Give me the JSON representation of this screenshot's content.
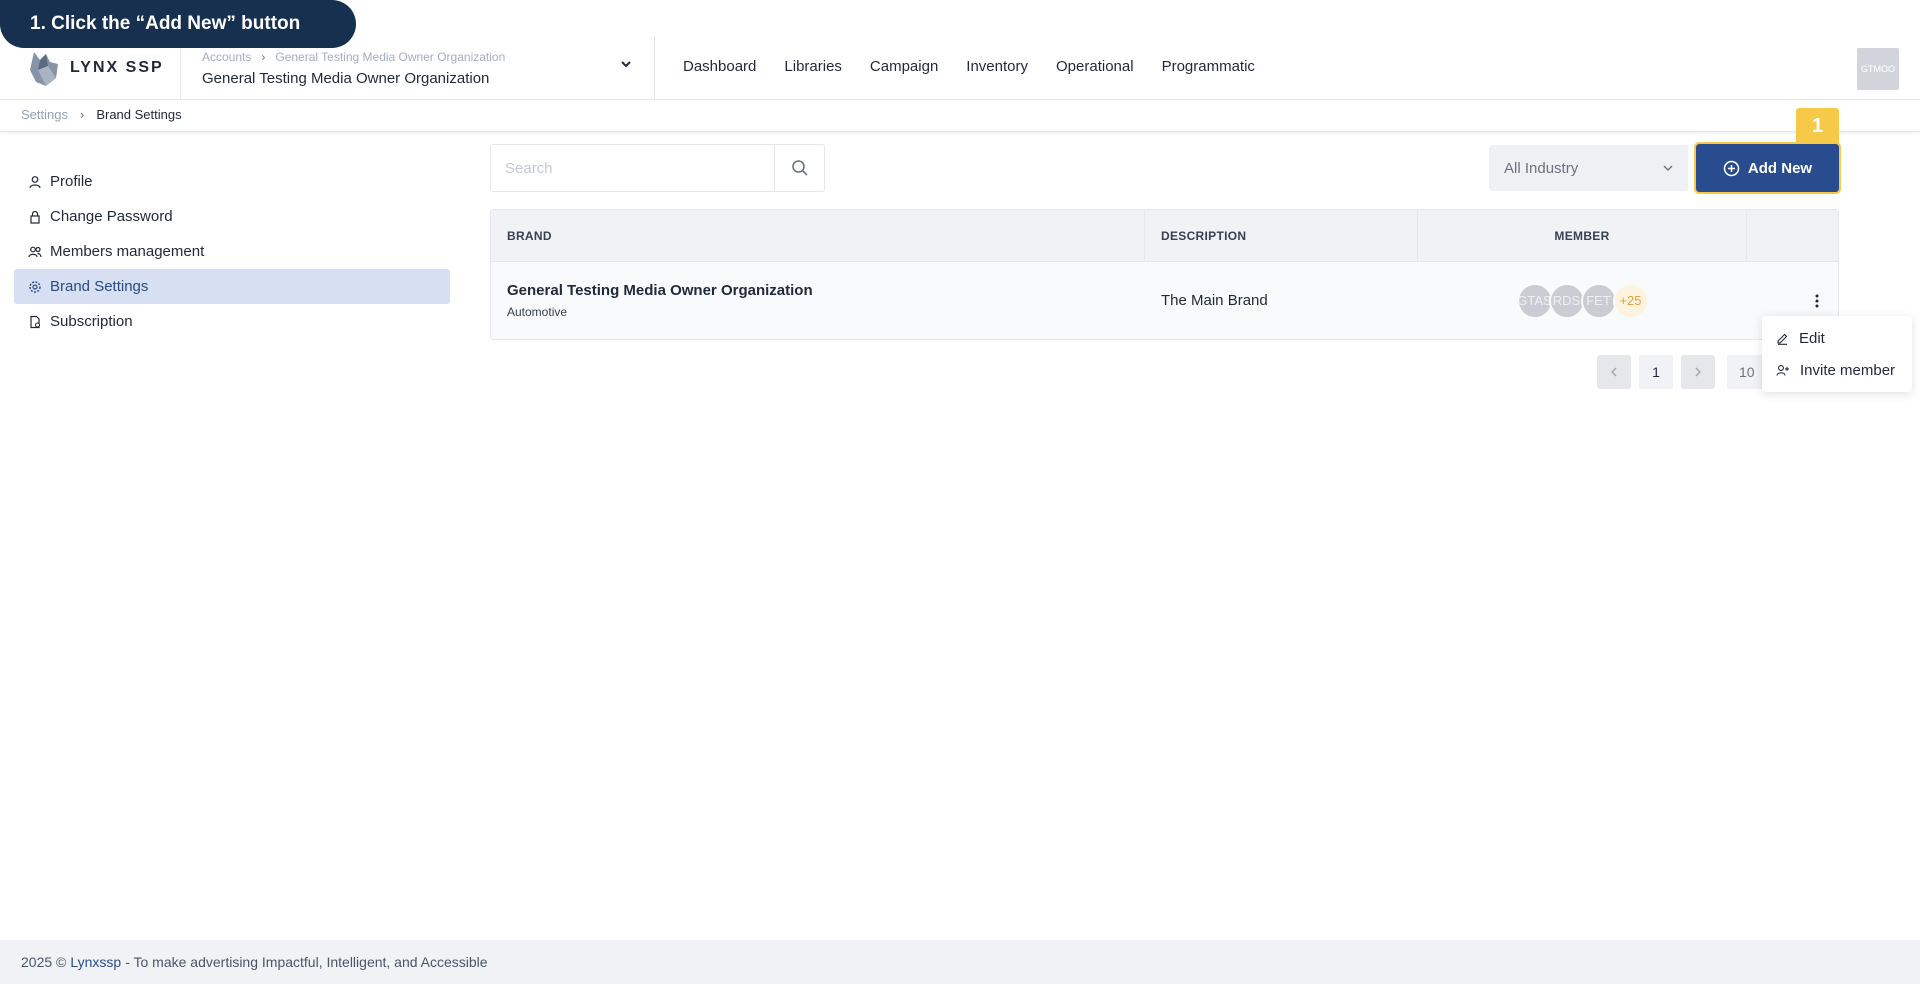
{
  "tutorial": {
    "step_text": "1. Click the “Add New” button",
    "badge_number": "1"
  },
  "header": {
    "logo_text": "LYNX SSP",
    "account_breadcrumb": [
      "Accounts",
      "General Testing Media Owner Organization"
    ],
    "account_title": "General Testing Media Owner Organization",
    "nav": [
      "Dashboard",
      "Libraries",
      "Campaign",
      "Inventory",
      "Operational",
      "Programmatic"
    ],
    "avatar_text": "GTMOO"
  },
  "breadcrumb": {
    "parent": "Settings",
    "current": "Brand Settings"
  },
  "sidebar": {
    "items": [
      {
        "label": "Profile",
        "icon": "user-icon"
      },
      {
        "label": "Change Password",
        "icon": "lock-icon"
      },
      {
        "label": "Members management",
        "icon": "users-icon"
      },
      {
        "label": "Brand Settings",
        "icon": "gear-icon",
        "active": true
      },
      {
        "label": "Subscription",
        "icon": "document-icon"
      }
    ]
  },
  "toolbar": {
    "search_placeholder": "Search",
    "industry_select": "All Industry",
    "add_new_label": "Add New"
  },
  "table": {
    "headers": {
      "brand": "BRAND",
      "description": "DESCRIPTION",
      "member": "MEMBER"
    },
    "rows": [
      {
        "brand": "General Testing Media Owner Organization",
        "industry": "Automotive",
        "description": "The Main Brand",
        "members": [
          "GTAS",
          "RDS",
          "FET"
        ],
        "more_members": "+25"
      }
    ]
  },
  "pagination": {
    "current_page": "1",
    "page_size": "10"
  },
  "row_menu": {
    "edit": "Edit",
    "invite": "Invite member"
  },
  "footer": {
    "prefix": "2025 ©",
    "link": "Lynxssp",
    "suffix": "- To make advertising Impactful, Intelligent, and Accessible"
  },
  "colors": {
    "primary": "#294c8e",
    "highlight": "#f7c948",
    "banner": "#17304f",
    "active_sidebar_bg": "#d6e0f2"
  }
}
